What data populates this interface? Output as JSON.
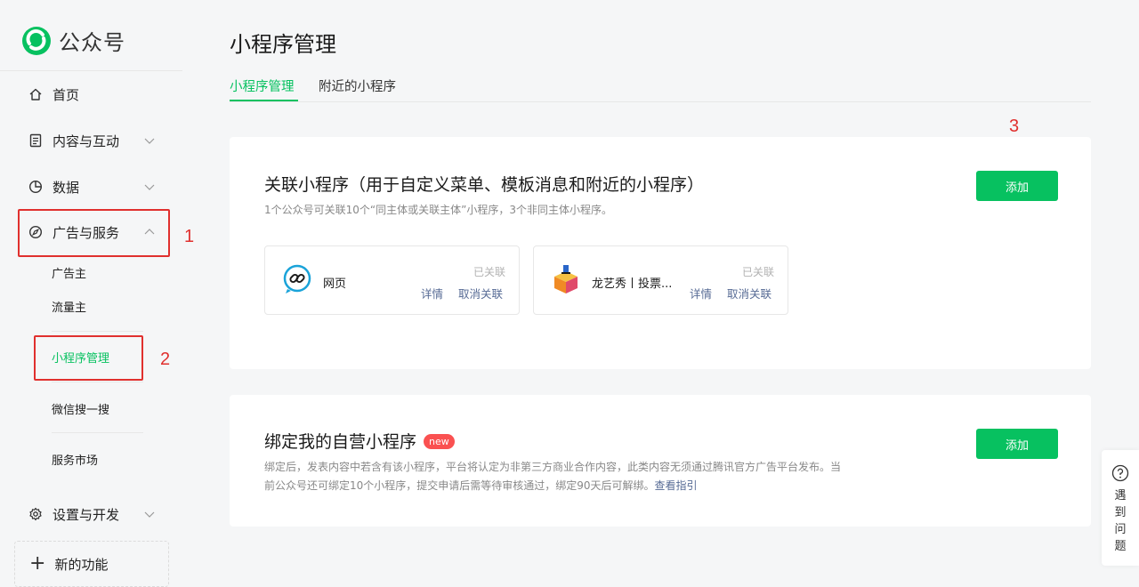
{
  "app": {
    "logo_text": "公众号",
    "brand_color": "#07c160"
  },
  "sidebar": {
    "items": [
      {
        "label": "首页",
        "icon": "home-icon"
      },
      {
        "label": "内容与互动",
        "icon": "document-icon"
      },
      {
        "label": "数据",
        "icon": "pie-chart-icon"
      },
      {
        "label": "广告与服务",
        "icon": "compass-icon"
      },
      {
        "label": "设置与开发",
        "icon": "gear-icon"
      }
    ],
    "ad_service_subitems": [
      "广告主",
      "流量主",
      "小程序管理",
      "微信搜一搜",
      "服务市场"
    ],
    "active_subitem": "小程序管理",
    "new_feature_label": "新的功能"
  },
  "annotations": {
    "step1": "1",
    "step2": "2",
    "step3": "3",
    "color": "#e0302e"
  },
  "main": {
    "title": "小程序管理",
    "tabs": [
      "小程序管理",
      "附近的小程序"
    ],
    "linked_card": {
      "title": "关联小程序（用于自定义菜单、模板消息和附近的小程序）",
      "desc": "1个公众号可关联10个“同主体或关联主体”小程序，3个非同主体小程序。",
      "add_label": "添加",
      "programs": [
        {
          "name": "网页",
          "status": "已关联",
          "detail": "详情",
          "unlink": "取消关联",
          "icon": "link-icon"
        },
        {
          "name": "龙艺秀丨投票...",
          "status": "已关联",
          "detail": "详情",
          "unlink": "取消关联",
          "icon": "cube-icon"
        }
      ]
    },
    "bind_card": {
      "title": "绑定我的自营小程序",
      "badge": "new",
      "desc_line1": "绑定后，发表内容中若含有该小程序，平台将认定为非第三方商业合作内容，此类内容无须通过腾讯官方广告平台发布。当",
      "desc_line2": "前公众号还可绑定10个小程序，提交申请后需等待审核通过，绑定90天后可解绑。",
      "guide_link": "查看指引",
      "add_label": "添加"
    }
  },
  "help": {
    "label": "遇到问题"
  }
}
